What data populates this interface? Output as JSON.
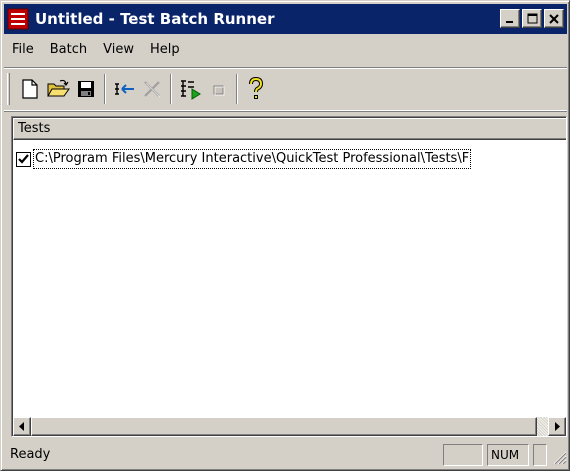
{
  "window": {
    "title": "Untitled - Test Batch Runner",
    "title_bar_color": "#0a246a",
    "caption_buttons": [
      "minimize-icon",
      "maximize-icon",
      "close-icon"
    ]
  },
  "menu": {
    "items": [
      "File",
      "Batch",
      "View",
      "Help"
    ]
  },
  "toolbar": {
    "buttons": [
      {
        "icon": "new-file-icon",
        "enabled": true
      },
      {
        "icon": "open-folder-icon",
        "enabled": true
      },
      {
        "icon": "save-icon",
        "enabled": true
      },
      {
        "icon": "add-test-icon",
        "enabled": true
      },
      {
        "icon": "delete-icon",
        "enabled": false
      },
      {
        "icon": "run-batch-icon",
        "enabled": true
      },
      {
        "icon": "stop-icon",
        "enabled": false
      },
      {
        "icon": "help-icon",
        "enabled": true
      }
    ]
  },
  "list": {
    "column_header": "Tests",
    "rows": [
      {
        "checked": true,
        "text": "C:\\Program Files\\Mercury Interactive\\QuickTest Professional\\Tests\\F"
      }
    ]
  },
  "status": {
    "text": "Ready",
    "panes": [
      "",
      "NUM",
      ""
    ]
  }
}
